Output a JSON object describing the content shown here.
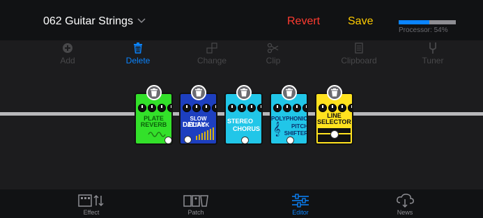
{
  "header": {
    "patch_name": "062 Guitar Strings",
    "revert_label": "Revert",
    "save_label": "Save",
    "processor_label": "Processor: 54%",
    "processor_fraction": 0.54
  },
  "toolbar": {
    "add": "Add",
    "delete": "Delete",
    "change": "Change",
    "clip": "Clip",
    "clipboard": "Clipboard",
    "tuner": "Tuner"
  },
  "pedals": [
    {
      "line1": "PLATE",
      "line2": "REVERB",
      "color": "#33e02a"
    },
    {
      "line1": "SLOW ATTACK",
      "line2": "DELAY",
      "color": "#1d3fbf"
    },
    {
      "line1": "STEREO",
      "line2": "CHORUS",
      "color": "#21c6e8"
    },
    {
      "line1": "POLYPHONIC",
      "line2": "PITCH SHIFTER",
      "color": "#21c6e8"
    },
    {
      "line1": "LINE",
      "line2": "SELECTOR",
      "color": "#ffe21f"
    }
  ],
  "tabs": {
    "effect": "Effect",
    "patch": "Patch",
    "editor": "Editor",
    "news": "News"
  },
  "colors": {
    "accent": "#0a84ff",
    "revert": "#ff3b30",
    "save": "#ffcc00"
  }
}
